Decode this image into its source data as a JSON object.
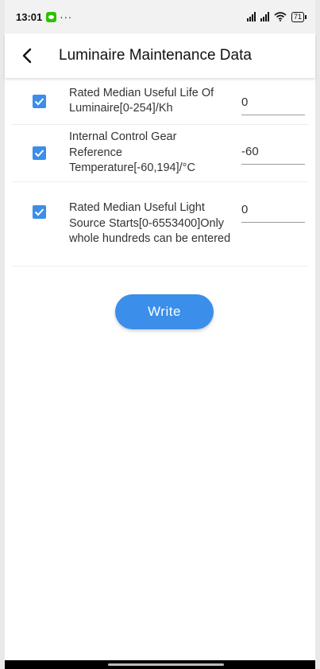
{
  "status_bar": {
    "time": "13:01",
    "dots": "···",
    "battery": "71"
  },
  "app_bar": {
    "title": "Luminaire Maintenance Data"
  },
  "rows": [
    {
      "label": "Rated Median Useful Life Of Luminaire[0-254]/Kh",
      "value": "0",
      "checked": true
    },
    {
      "label": "Internal Control Gear Reference Temperature[-60,194]/°C",
      "value": "-60",
      "checked": true
    },
    {
      "label": "Rated Median Useful Light Source Starts[0-6553400]Only whole hundreds can be entered",
      "value": "0",
      "checked": true
    }
  ],
  "write_button": {
    "label": "Write"
  },
  "colors": {
    "accent": "#3b8eea"
  }
}
